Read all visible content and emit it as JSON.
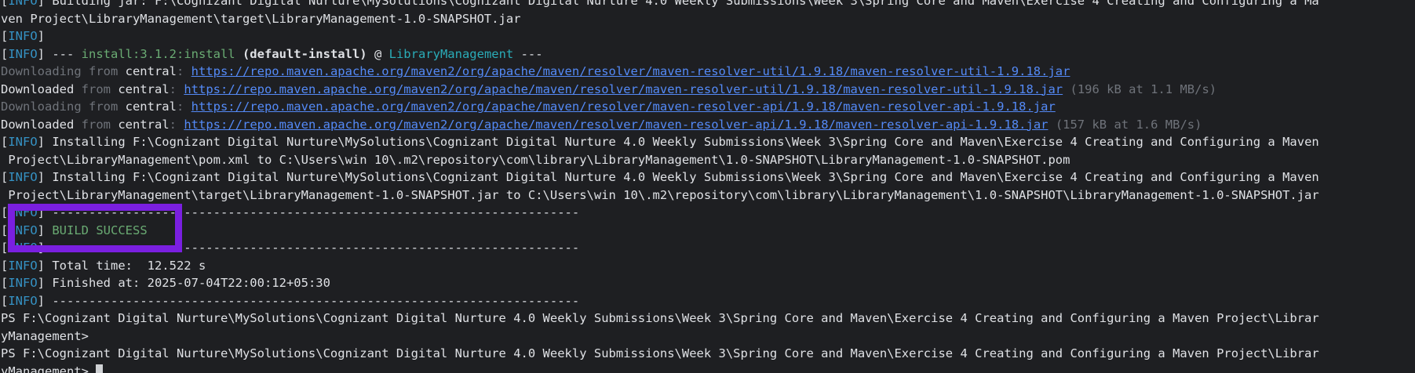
{
  "colors": {
    "background": "#1e1f22",
    "info_tag": "#3592c4",
    "success": "#6aab73",
    "link": "#548af7",
    "dim": "#6f737a",
    "highlight": "#7a1fe0"
  },
  "terminal": {
    "lines": [
      {
        "segs": [
          {
            "t": "[",
            "c": "white"
          },
          {
            "t": "INFO",
            "c": "info"
          },
          {
            "t": "] Building jar: F:\\Cognizant Digital Nurture\\MySolutions\\Cognizant Digital Nurture 4.0 Weekly Submissions\\Week 3\\Spring Core and Maven\\Exercise 4 Creating and Configuring a Ma",
            "c": "white"
          }
        ]
      },
      {
        "segs": [
          {
            "t": "ven Project\\LibraryManagement\\target\\LibraryManagement-1.0-SNAPSHOT.jar",
            "c": "white"
          }
        ]
      },
      {
        "segs": [
          {
            "t": "[",
            "c": "white"
          },
          {
            "t": "INFO",
            "c": "info"
          },
          {
            "t": "]",
            "c": "white"
          }
        ]
      },
      {
        "segs": [
          {
            "t": "[",
            "c": "white"
          },
          {
            "t": "INFO",
            "c": "info"
          },
          {
            "t": "] --- ",
            "c": "white"
          },
          {
            "t": "install:3.1.2:install",
            "c": "green"
          },
          {
            "t": " (default-install)",
            "c": "bold"
          },
          {
            "t": " @ ",
            "c": "white"
          },
          {
            "t": "LibraryManagement",
            "c": "cyan"
          },
          {
            "t": " ---",
            "c": "white"
          }
        ]
      },
      {
        "segs": [
          {
            "t": "Downloading from",
            "c": "dim"
          },
          {
            "t": " central",
            "c": "white"
          },
          {
            "t": ": ",
            "c": "dim"
          },
          {
            "t": "https://repo.maven.apache.org/maven2/org/apache/maven/resolver/maven-resolver-util/1.9.18/maven-resolver-util-1.9.18.jar",
            "c": "link"
          }
        ]
      },
      {
        "segs": [
          {
            "t": "Downloaded",
            "c": "white"
          },
          {
            "t": " from",
            "c": "dim"
          },
          {
            "t": " central",
            "c": "white"
          },
          {
            "t": ": ",
            "c": "dim"
          },
          {
            "t": "https://repo.maven.apache.org/maven2/org/apache/maven/resolver/maven-resolver-util/1.9.18/maven-resolver-util-1.9.18.jar",
            "c": "link"
          },
          {
            "t": " (196 kB at 1.1 MB/s)",
            "c": "dim"
          }
        ]
      },
      {
        "segs": [
          {
            "t": "Downloading from",
            "c": "dim"
          },
          {
            "t": " central",
            "c": "white"
          },
          {
            "t": ": ",
            "c": "dim"
          },
          {
            "t": "https://repo.maven.apache.org/maven2/org/apache/maven/resolver/maven-resolver-api/1.9.18/maven-resolver-api-1.9.18.jar",
            "c": "link"
          }
        ]
      },
      {
        "segs": [
          {
            "t": "Downloaded",
            "c": "white"
          },
          {
            "t": " from",
            "c": "dim"
          },
          {
            "t": " central",
            "c": "white"
          },
          {
            "t": ": ",
            "c": "dim"
          },
          {
            "t": "https://repo.maven.apache.org/maven2/org/apache/maven/resolver/maven-resolver-api/1.9.18/maven-resolver-api-1.9.18.jar",
            "c": "link"
          },
          {
            "t": " (157 kB at 1.6 MB/s)",
            "c": "dim"
          }
        ]
      },
      {
        "segs": [
          {
            "t": "[",
            "c": "white"
          },
          {
            "t": "INFO",
            "c": "info"
          },
          {
            "t": "] Installing F:\\Cognizant Digital Nurture\\MySolutions\\Cognizant Digital Nurture 4.0 Weekly Submissions\\Week 3\\Spring Core and Maven\\Exercise 4 Creating and Configuring a Maven",
            "c": "white"
          }
        ]
      },
      {
        "segs": [
          {
            "t": " Project\\LibraryManagement\\pom.xml to C:\\Users\\win 10\\.m2\\repository\\com\\library\\LibraryManagement\\1.0-SNAPSHOT\\LibraryManagement-1.0-SNAPSHOT.pom",
            "c": "white"
          }
        ]
      },
      {
        "segs": [
          {
            "t": "[",
            "c": "white"
          },
          {
            "t": "INFO",
            "c": "info"
          },
          {
            "t": "] Installing F:\\Cognizant Digital Nurture\\MySolutions\\Cognizant Digital Nurture 4.0 Weekly Submissions\\Week 3\\Spring Core and Maven\\Exercise 4 Creating and Configuring a Maven",
            "c": "white"
          }
        ]
      },
      {
        "segs": [
          {
            "t": " Project\\LibraryManagement\\target\\LibraryManagement-1.0-SNAPSHOT.jar to C:\\Users\\win 10\\.m2\\repository\\com\\library\\LibraryManagement\\1.0-SNAPSHOT\\LibraryManagement-1.0-SNAPSHOT.jar",
            "c": "white"
          }
        ]
      },
      {
        "segs": [
          {
            "t": "[",
            "c": "white"
          },
          {
            "t": "INFO",
            "c": "info"
          },
          {
            "t": "] ------------------------------------------------------------------------",
            "c": "white"
          }
        ]
      },
      {
        "segs": [
          {
            "t": "[",
            "c": "white"
          },
          {
            "t": "INFO",
            "c": "info"
          },
          {
            "t": "] ",
            "c": "white"
          },
          {
            "t": "BUILD SUCCESS",
            "c": "green"
          }
        ]
      },
      {
        "segs": [
          {
            "t": "[",
            "c": "white"
          },
          {
            "t": "INFO",
            "c": "info"
          },
          {
            "t": "] ------------------------------------------------------------------------",
            "c": "white"
          }
        ]
      },
      {
        "segs": [
          {
            "t": "[",
            "c": "white"
          },
          {
            "t": "INFO",
            "c": "info"
          },
          {
            "t": "] Total time:  12.522 s",
            "c": "white"
          }
        ]
      },
      {
        "segs": [
          {
            "t": "[",
            "c": "white"
          },
          {
            "t": "INFO",
            "c": "info"
          },
          {
            "t": "] Finished at: 2025-07-04T22:00:12+05:30",
            "c": "white"
          }
        ]
      },
      {
        "segs": [
          {
            "t": "[",
            "c": "white"
          },
          {
            "t": "INFO",
            "c": "info"
          },
          {
            "t": "] ------------------------------------------------------------------------",
            "c": "white"
          }
        ]
      },
      {
        "segs": [
          {
            "t": "PS F:\\Cognizant Digital Nurture\\MySolutions\\Cognizant Digital Nurture 4.0 Weekly Submissions\\Week 3\\Spring Core and Maven\\Exercise 4 Creating and Configuring a Maven Project\\Librar",
            "c": "white"
          }
        ]
      },
      {
        "segs": [
          {
            "t": "yManagement>",
            "c": "white"
          }
        ]
      },
      {
        "segs": [
          {
            "t": "PS F:\\Cognizant Digital Nurture\\MySolutions\\Cognizant Digital Nurture 4.0 Weekly Submissions\\Week 3\\Spring Core and Maven\\Exercise 4 Creating and Configuring a Maven Project\\Librar",
            "c": "white"
          }
        ]
      },
      {
        "segs": [
          {
            "t": "yManagement> ",
            "c": "white"
          }
        ],
        "cursor": true
      }
    ]
  }
}
